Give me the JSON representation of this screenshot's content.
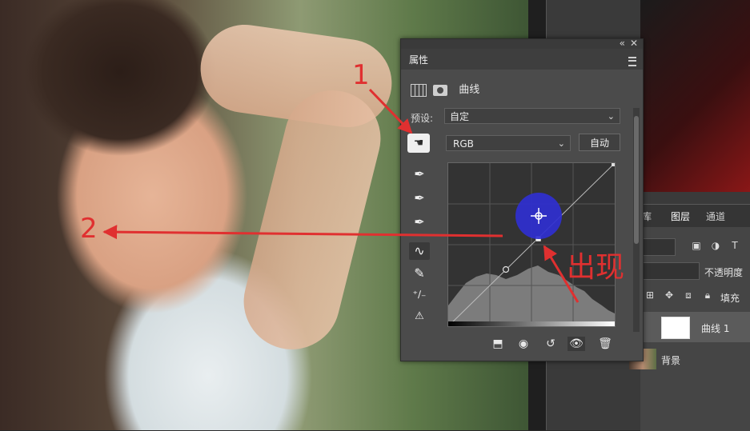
{
  "panel": {
    "title": "属性",
    "adjustment_name": "曲线",
    "preset_label": "预设:",
    "preset_value": "自定",
    "channel_value": "RGB",
    "auto_button": "自动"
  },
  "layers": {
    "tabs": [
      "库",
      "图层",
      "通道"
    ],
    "opacity_label": "不透明度",
    "fill_label": "填充",
    "layer1_name": "曲线 1",
    "layer2_name": "背景"
  },
  "annotations": {
    "label_1": "1",
    "label_2": "2",
    "label_appear": "出现"
  },
  "icons": {
    "titlebar": [
      "collapse-icon",
      "close-icon"
    ],
    "tools": [
      "target-adjust-icon",
      "black-eyedropper-icon",
      "gray-eyedropper-icon",
      "white-eyedropper-icon",
      "curve-edit-icon",
      "pencil-icon",
      "smooth-icon",
      "clipping-warning-icon"
    ],
    "bottom": [
      "clip-to-layer-icon",
      "view-previous-icon",
      "reset-icon",
      "visibility-icon",
      "delete-icon"
    ]
  },
  "colors": {
    "annotation_red": "#e03030",
    "highlight_blue": "#2f2fd0"
  }
}
